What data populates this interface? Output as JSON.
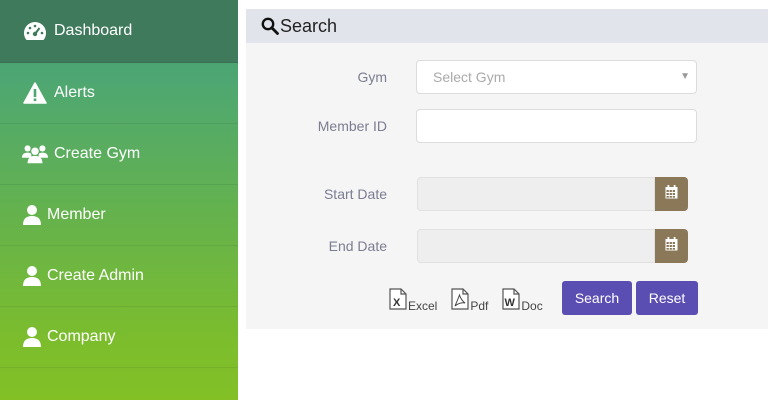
{
  "sidebar": {
    "items": [
      {
        "label": "Dashboard",
        "icon": "dashboard-gauge-icon",
        "active": true
      },
      {
        "label": "Alerts",
        "icon": "warning-icon"
      },
      {
        "label": "Create Gym",
        "icon": "group-icon"
      },
      {
        "label": "Member",
        "icon": "user-icon"
      },
      {
        "label": "Create Admin",
        "icon": "user-icon"
      },
      {
        "label": "Company",
        "icon": "user-icon"
      }
    ]
  },
  "search": {
    "title": "Search",
    "gym_label": "Gym",
    "gym_placeholder": "Select Gym",
    "member_id_label": "Member ID",
    "member_id_value": "",
    "start_date_label": "Start Date",
    "start_date_value": "",
    "end_date_label": "End Date",
    "end_date_value": "",
    "exports": {
      "excel": "Excel",
      "pdf": "Pdf",
      "doc": "Doc"
    },
    "search_button": "Search",
    "reset_button": "Reset"
  },
  "colors": {
    "sidebar_active": "#3f7a5c",
    "sidebar_bottom": "#82c026",
    "panel_head": "#e1e4ea",
    "date_button": "#8a7858",
    "primary_button": "#5b4eb2"
  }
}
